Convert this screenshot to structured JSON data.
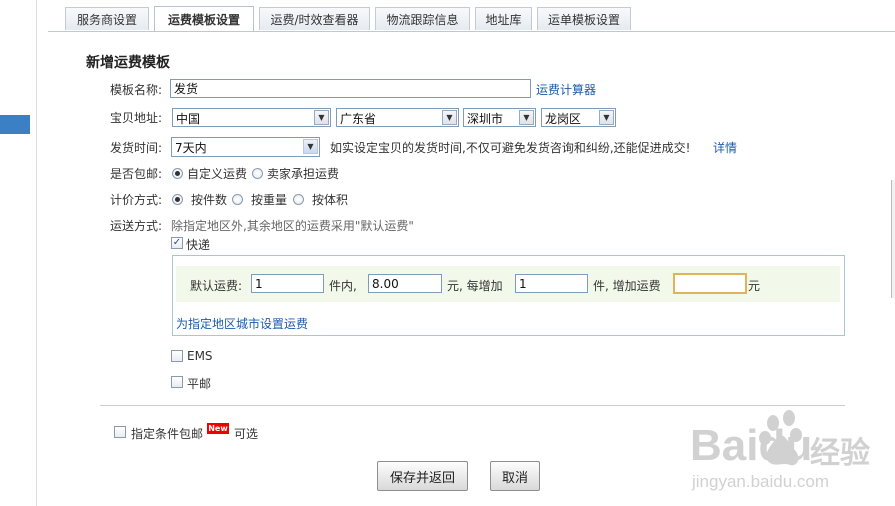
{
  "tabs": [
    {
      "label": "服务商设置"
    },
    {
      "label": "运费模板设置"
    },
    {
      "label": "运费/时效查看器"
    },
    {
      "label": "物流跟踪信息"
    },
    {
      "label": "地址库"
    },
    {
      "label": "运单模板设置"
    }
  ],
  "page_title": "新增运费模板",
  "template_name": {
    "label": "模板名称:",
    "value": "发货",
    "calculator_link": "运费计算器"
  },
  "address": {
    "label": "宝贝地址:",
    "country": "中国",
    "province": "广东省",
    "city": "深圳市",
    "district": "龙岗区"
  },
  "ship_time": {
    "label": "发货时间:",
    "value": "7天内",
    "hint": "如实设定宝贝的发货时间,不仅可避免发货咨询和纠纷,还能促进成交!",
    "details_link": "详情"
  },
  "free_shipping": {
    "label": "是否包邮:",
    "options": [
      "自定义运费",
      "卖家承担运费"
    ],
    "selected": 0
  },
  "pricing": {
    "label": "计价方式:",
    "options": [
      "按件数",
      "按重量",
      "按体积"
    ],
    "selected": 0
  },
  "delivery": {
    "label": "运送方式:",
    "hint": "除指定地区外,其余地区的运费采用\"默认运费\"",
    "express": {
      "label": "快递",
      "checked": true,
      "default_fee_label": "默认运费:",
      "first_qty": "1",
      "text_items_within": "件内,",
      "first_fee": "8.00",
      "text_yuan_each": "元, 每增加",
      "add_qty": "1",
      "text_items_add": "件, 增加运费",
      "add_fee": "",
      "text_yuan": "元",
      "region_link": "为指定地区城市设置运费"
    },
    "ems": {
      "label": "EMS",
      "checked": false
    },
    "surface": {
      "label": "平邮",
      "checked": false
    }
  },
  "conditional_free": {
    "label": "指定条件包邮",
    "badge": "New",
    "suffix": "可选",
    "checked": false
  },
  "buttons": {
    "save": "保存并返回",
    "cancel": "取消"
  },
  "watermark": {
    "brand": "Baidu",
    "cn": "经验",
    "url": "jingyan.baidu.com"
  }
}
